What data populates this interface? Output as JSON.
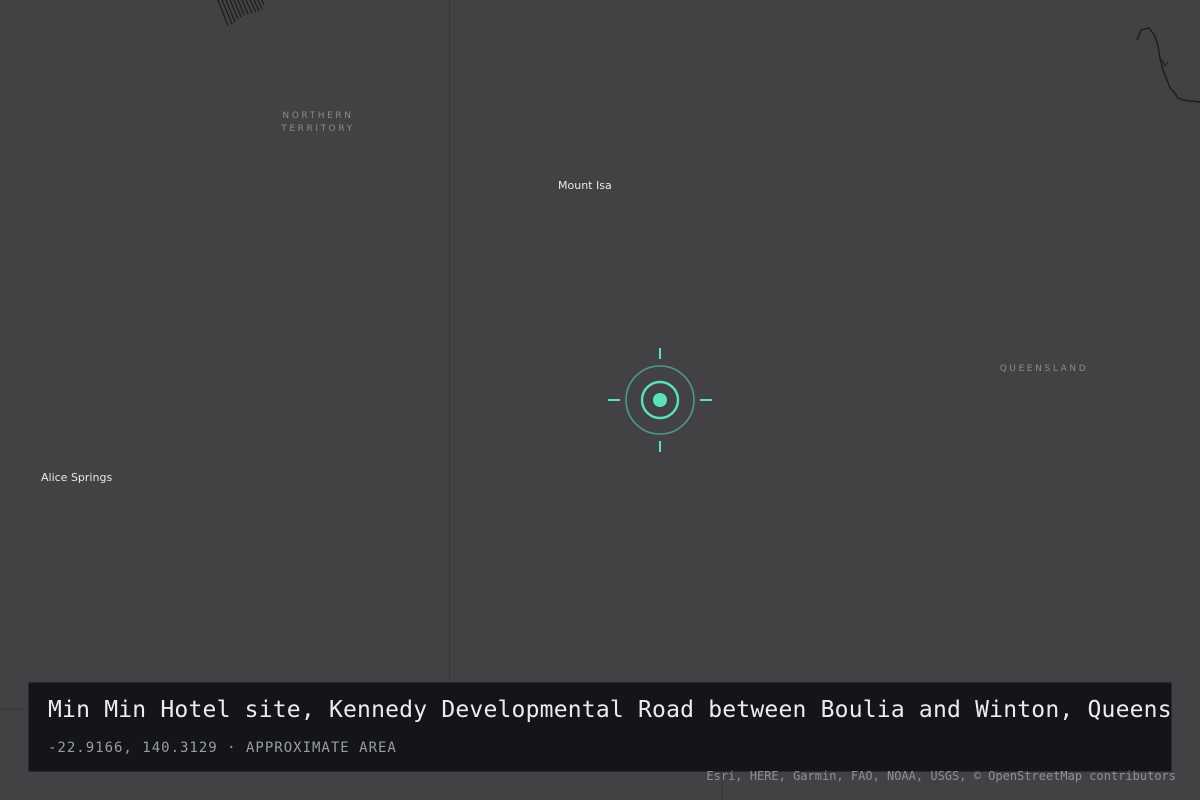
{
  "map": {
    "labels": {
      "northern_territory_line1": "NORTHERN",
      "northern_territory_line2": "TERRITORY",
      "queensland": "QUEENSLAND",
      "mount_isa": "Mount Isa",
      "alice_springs": "Alice Springs"
    },
    "colors": {
      "background": "#424244",
      "marker_accent": "#5ce0c0",
      "panel_background": "#141519"
    },
    "marker": {
      "icon": "crosshair-target-icon"
    }
  },
  "info_panel": {
    "place_name": "Min Min Hotel site, Kennedy Developmental Road between Boulia and Winton, Queensland",
    "coords_line": "-22.9166, 140.3129 · APPROXIMATE AREA"
  },
  "attribution": "Esri, HERE, Garmin, FAO, NOAA, USGS, © OpenStreetMap contributors"
}
